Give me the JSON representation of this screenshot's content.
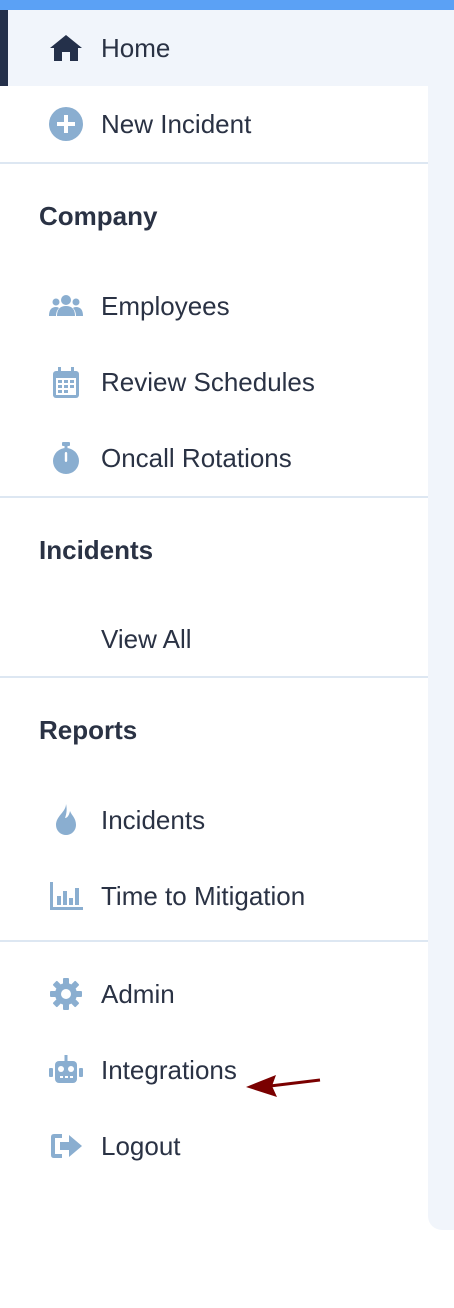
{
  "sidebar": {
    "main": [
      {
        "label": "Home",
        "icon": "home-icon"
      },
      {
        "label": "New Incident",
        "icon": "plus-circle-icon"
      }
    ],
    "sections": [
      {
        "title": "Company",
        "items": [
          {
            "label": "Employees",
            "icon": "users-icon"
          },
          {
            "label": "Review Schedules",
            "icon": "calendar-icon"
          },
          {
            "label": "Oncall Rotations",
            "icon": "stopwatch-icon"
          }
        ]
      },
      {
        "title": "Incidents",
        "items": [
          {
            "label": "View All",
            "icon": ""
          }
        ]
      },
      {
        "title": "Reports",
        "items": [
          {
            "label": "Incidents",
            "icon": "fire-icon"
          },
          {
            "label": "Time to Mitigation",
            "icon": "bar-chart-icon"
          }
        ]
      }
    ],
    "footer": [
      {
        "label": "Admin",
        "icon": "gear-icon"
      },
      {
        "label": "Integrations",
        "icon": "robot-icon"
      },
      {
        "label": "Logout",
        "icon": "logout-icon"
      }
    ]
  },
  "colors": {
    "accent": "#5ba1f5",
    "icon": "#8aaed0",
    "active_bar": "#24304a",
    "annotation_arrow": "#7a0000"
  }
}
